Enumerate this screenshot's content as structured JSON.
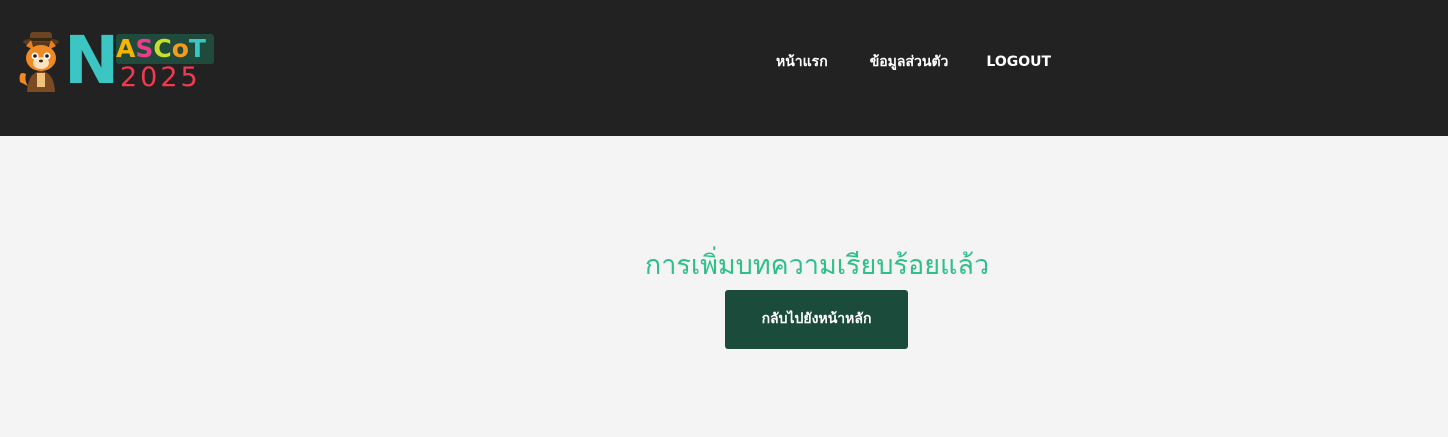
{
  "header": {
    "logo": {
      "big_letter": "N",
      "letters": [
        {
          "char": "A",
          "color": "#f5b400"
        },
        {
          "char": "S",
          "color": "#e83e8c"
        },
        {
          "char": "C",
          "color": "#c8e02a"
        },
        {
          "char": "o",
          "color": "#f59a1e"
        },
        {
          "char": "T",
          "color": "#3cc6c3"
        }
      ],
      "year": "2025",
      "mascot_icon": "fox-mascot-icon"
    },
    "nav": {
      "home_label": "หน้าแรก",
      "profile_label": "ข้อมูลส่วนตัว",
      "logout_label": "LOGOUT"
    },
    "background_color": "#222222"
  },
  "main": {
    "message": "การเพิ่มบทความเรียบร้อยแล้ว",
    "message_color": "#2fbf8a",
    "back_button_label": "กลับไปยังหน้าหลัก",
    "back_button_color": "#1b4b3a"
  }
}
